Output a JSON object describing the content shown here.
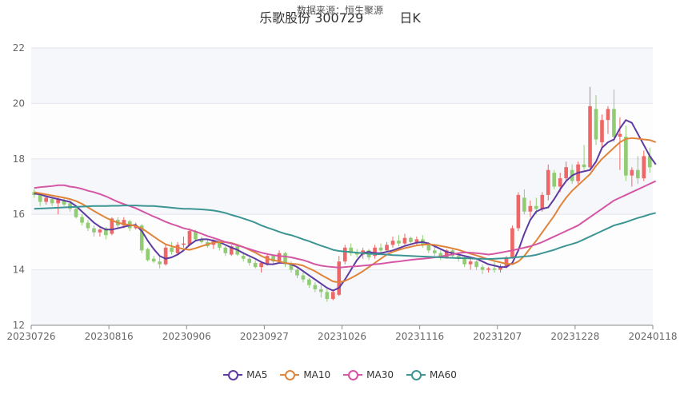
{
  "header": {
    "source": "数据来源：恒生聚源",
    "stock": "乐歌股份 300729",
    "period": "日K"
  },
  "colors": {
    "up": "#ee6666",
    "down": "#91cc75",
    "MA5": "#5e3ba0",
    "MA10": "#e0843b",
    "MA30": "#d456a4",
    "MA60": "#3c9593"
  },
  "chart_data": {
    "type": "candlestick",
    "title": "乐歌股份 300729",
    "subtitle": "日K",
    "ylim": [
      12,
      22
    ],
    "yticks": [
      12,
      14,
      16,
      18,
      20,
      22
    ],
    "xticks": [
      "20230726",
      "20230816",
      "20230906",
      "20230927",
      "20231026",
      "20231116",
      "20231207",
      "20231228",
      "20240118"
    ],
    "grid": true,
    "legend_position": "bottom",
    "legend": [
      "MA5",
      "MA10",
      "MA30",
      "MA60"
    ],
    "ohlc": [
      [
        16.8,
        16.9,
        16.6,
        16.7
      ],
      [
        16.7,
        16.75,
        16.3,
        16.45
      ],
      [
        16.45,
        16.7,
        16.35,
        16.6
      ],
      [
        16.55,
        16.6,
        16.3,
        16.4
      ],
      [
        16.4,
        16.6,
        16.0,
        16.55
      ],
      [
        16.5,
        16.6,
        16.3,
        16.35
      ],
      [
        16.4,
        16.5,
        16.1,
        16.2
      ],
      [
        16.2,
        16.3,
        15.85,
        15.9
      ],
      [
        15.9,
        16.0,
        15.6,
        15.7
      ],
      [
        15.7,
        15.8,
        15.4,
        15.5
      ],
      [
        15.5,
        15.6,
        15.2,
        15.35
      ],
      [
        15.35,
        15.5,
        15.2,
        15.45
      ],
      [
        15.5,
        15.55,
        15.1,
        15.25
      ],
      [
        15.3,
        15.9,
        15.25,
        15.85
      ],
      [
        15.8,
        15.9,
        15.5,
        15.6
      ],
      [
        15.6,
        15.9,
        15.5,
        15.8
      ],
      [
        15.75,
        15.8,
        15.4,
        15.5
      ],
      [
        15.5,
        15.7,
        15.45,
        15.6
      ],
      [
        15.6,
        15.65,
        14.6,
        14.7
      ],
      [
        14.75,
        14.8,
        14.3,
        14.35
      ],
      [
        14.4,
        14.5,
        14.25,
        14.3
      ],
      [
        14.3,
        14.5,
        14.05,
        14.2
      ],
      [
        14.2,
        14.9,
        14.15,
        14.8
      ],
      [
        14.8,
        15.0,
        14.55,
        14.65
      ],
      [
        14.6,
        15.0,
        14.55,
        14.9
      ],
      [
        14.9,
        15.2,
        14.8,
        14.95
      ],
      [
        14.9,
        15.5,
        14.85,
        15.4
      ],
      [
        15.4,
        15.45,
        15.05,
        15.1
      ],
      [
        15.1,
        15.2,
        14.95,
        15.0
      ],
      [
        15.0,
        15.1,
        14.8,
        14.85
      ],
      [
        14.9,
        15.1,
        14.75,
        15.05
      ],
      [
        15.0,
        15.05,
        14.7,
        14.8
      ],
      [
        14.8,
        14.85,
        14.5,
        14.6
      ],
      [
        14.55,
        14.9,
        14.5,
        14.85
      ],
      [
        14.85,
        14.9,
        14.5,
        14.55
      ],
      [
        14.5,
        14.65,
        14.3,
        14.4
      ],
      [
        14.4,
        14.45,
        14.15,
        14.25
      ],
      [
        14.25,
        14.35,
        14.05,
        14.1
      ],
      [
        14.1,
        14.3,
        13.9,
        14.25
      ],
      [
        14.2,
        14.6,
        14.15,
        14.5
      ],
      [
        14.5,
        14.55,
        14.2,
        14.3
      ],
      [
        14.3,
        14.7,
        14.25,
        14.6
      ],
      [
        14.6,
        14.65,
        14.1,
        14.2
      ],
      [
        14.2,
        14.3,
        13.9,
        14.0
      ],
      [
        14.0,
        14.05,
        13.7,
        13.8
      ],
      [
        13.8,
        13.9,
        13.55,
        13.65
      ],
      [
        13.65,
        13.7,
        13.35,
        13.45
      ],
      [
        13.45,
        13.55,
        13.2,
        13.3
      ],
      [
        13.3,
        13.45,
        13.0,
        13.2
      ],
      [
        13.2,
        13.3,
        12.85,
        12.95
      ],
      [
        12.95,
        13.3,
        12.9,
        13.2
      ],
      [
        13.1,
        14.5,
        13.05,
        14.3
      ],
      [
        14.3,
        14.9,
        14.2,
        14.8
      ],
      [
        14.8,
        14.95,
        14.5,
        14.6
      ],
      [
        14.6,
        14.75,
        14.45,
        14.55
      ],
      [
        14.55,
        14.8,
        14.4,
        14.7
      ],
      [
        14.7,
        14.75,
        14.35,
        14.45
      ],
      [
        14.5,
        14.9,
        14.4,
        14.8
      ],
      [
        14.8,
        14.95,
        14.6,
        14.7
      ],
      [
        14.7,
        15.0,
        14.65,
        14.9
      ],
      [
        14.9,
        15.2,
        14.8,
        15.05
      ],
      [
        15.05,
        15.25,
        14.85,
        14.95
      ],
      [
        14.95,
        15.3,
        14.9,
        15.15
      ],
      [
        15.15,
        15.2,
        14.9,
        15.0
      ],
      [
        15.0,
        15.2,
        14.85,
        15.1
      ],
      [
        15.1,
        15.25,
        14.8,
        14.9
      ],
      [
        14.9,
        15.0,
        14.6,
        14.7
      ],
      [
        14.7,
        14.85,
        14.5,
        14.6
      ],
      [
        14.6,
        14.7,
        14.35,
        14.45
      ],
      [
        14.45,
        14.75,
        14.4,
        14.7
      ],
      [
        14.7,
        14.8,
        14.45,
        14.5
      ],
      [
        14.5,
        14.6,
        14.3,
        14.4
      ],
      [
        14.4,
        14.5,
        14.1,
        14.2
      ],
      [
        14.2,
        14.4,
        14.0,
        14.3
      ],
      [
        14.3,
        14.35,
        14.0,
        14.1
      ],
      [
        14.1,
        14.2,
        13.85,
        14.0
      ],
      [
        14.0,
        14.1,
        13.9,
        14.05
      ],
      [
        14.05,
        14.3,
        13.9,
        14.0
      ],
      [
        14.0,
        14.2,
        13.9,
        14.1
      ],
      [
        14.1,
        14.5,
        14.05,
        14.45
      ],
      [
        14.45,
        15.6,
        14.4,
        15.5
      ],
      [
        15.5,
        16.8,
        15.4,
        16.7
      ],
      [
        16.6,
        16.9,
        16.0,
        16.1
      ],
      [
        16.1,
        16.5,
        15.9,
        16.3
      ],
      [
        16.3,
        16.6,
        16.0,
        16.2
      ],
      [
        16.2,
        16.8,
        16.1,
        16.7
      ],
      [
        16.7,
        17.8,
        16.5,
        17.6
      ],
      [
        17.5,
        17.6,
        16.9,
        17.0
      ],
      [
        17.0,
        17.5,
        16.8,
        17.3
      ],
      [
        17.3,
        17.9,
        17.2,
        17.7
      ],
      [
        17.6,
        17.8,
        17.1,
        17.2
      ],
      [
        17.2,
        17.9,
        17.1,
        17.8
      ],
      [
        17.8,
        18.5,
        17.6,
        17.7
      ],
      [
        17.7,
        20.6,
        17.6,
        19.9
      ],
      [
        19.8,
        20.3,
        18.5,
        18.7
      ],
      [
        18.6,
        19.6,
        18.4,
        19.4
      ],
      [
        19.4,
        19.9,
        18.9,
        19.8
      ],
      [
        19.8,
        20.5,
        18.6,
        18.8
      ],
      [
        18.8,
        19.5,
        17.6,
        18.9
      ],
      [
        18.8,
        19.2,
        17.2,
        17.4
      ],
      [
        17.4,
        17.7,
        17.0,
        17.6
      ],
      [
        17.6,
        18.1,
        17.1,
        17.3
      ],
      [
        17.3,
        18.3,
        17.2,
        18.1
      ],
      [
        18.1,
        18.4,
        17.5,
        17.7
      ]
    ],
    "series": [
      {
        "name": "MA5",
        "values": [
          16.75,
          16.72,
          16.65,
          16.6,
          16.55,
          16.5,
          16.45,
          16.3,
          16.1,
          15.9,
          15.7,
          15.55,
          15.45,
          15.45,
          15.5,
          15.55,
          15.6,
          15.62,
          15.4,
          15.05,
          14.75,
          14.5,
          14.4,
          14.45,
          14.55,
          14.7,
          14.9,
          15.05,
          15.1,
          15.1,
          15.05,
          15.0,
          14.9,
          14.8,
          14.72,
          14.6,
          14.5,
          14.4,
          14.28,
          14.2,
          14.2,
          14.25,
          14.25,
          14.2,
          14.1,
          13.95,
          13.8,
          13.65,
          13.5,
          13.35,
          13.25,
          13.35,
          13.65,
          14.0,
          14.35,
          14.6,
          14.65,
          14.6,
          14.6,
          14.65,
          14.7,
          14.78,
          14.86,
          14.92,
          14.98,
          15.0,
          14.95,
          14.85,
          14.75,
          14.65,
          14.6,
          14.55,
          14.5,
          14.45,
          14.4,
          14.3,
          14.2,
          14.15,
          14.1,
          14.1,
          14.25,
          14.7,
          15.3,
          15.8,
          16.1,
          16.2,
          16.25,
          16.55,
          16.9,
          17.2,
          17.4,
          17.5,
          17.55,
          17.6,
          17.9,
          18.4,
          18.6,
          18.7,
          19.1,
          19.4,
          19.3,
          18.9,
          18.5,
          18.1,
          17.8
        ]
      },
      {
        "name": "MA10",
        "values": [
          16.8,
          16.76,
          16.72,
          16.68,
          16.64,
          16.6,
          16.55,
          16.48,
          16.38,
          16.25,
          16.12,
          16.0,
          15.88,
          15.78,
          15.7,
          15.65,
          15.62,
          15.58,
          15.5,
          15.35,
          15.2,
          15.05,
          14.92,
          14.85,
          14.8,
          14.75,
          14.72,
          14.78,
          14.85,
          14.92,
          14.98,
          15.0,
          15.0,
          14.97,
          14.9,
          14.82,
          14.72,
          14.62,
          14.5,
          14.4,
          14.35,
          14.3,
          14.25,
          14.22,
          14.2,
          14.15,
          14.05,
          13.95,
          13.82,
          13.7,
          13.58,
          13.55,
          13.6,
          13.7,
          13.82,
          13.95,
          14.1,
          14.25,
          14.4,
          14.55,
          14.65,
          14.72,
          14.78,
          14.83,
          14.88,
          14.9,
          14.92,
          14.9,
          14.86,
          14.82,
          14.77,
          14.72,
          14.65,
          14.58,
          14.52,
          14.45,
          14.38,
          14.32,
          14.27,
          14.22,
          14.2,
          14.3,
          14.5,
          14.78,
          15.05,
          15.35,
          15.65,
          15.95,
          16.3,
          16.6,
          16.85,
          17.05,
          17.25,
          17.45,
          17.75,
          18.0,
          18.2,
          18.4,
          18.6,
          18.72,
          18.75,
          18.73,
          18.7,
          18.68,
          18.6
        ]
      },
      {
        "name": "MA30",
        "values": [
          16.95,
          16.98,
          17.0,
          17.02,
          17.05,
          17.05,
          17.0,
          16.97,
          16.92,
          16.85,
          16.8,
          16.73,
          16.65,
          16.55,
          16.45,
          16.37,
          16.3,
          16.22,
          16.12,
          16.02,
          15.92,
          15.83,
          15.73,
          15.65,
          15.58,
          15.5,
          15.45,
          15.38,
          15.3,
          15.22,
          15.15,
          15.08,
          15.0,
          14.95,
          14.88,
          14.82,
          14.75,
          14.68,
          14.62,
          14.57,
          14.53,
          14.5,
          14.48,
          14.45,
          14.4,
          14.35,
          14.28,
          14.2,
          14.15,
          14.12,
          14.1,
          14.08,
          14.1,
          14.12,
          14.13,
          14.15,
          14.17,
          14.2,
          14.22,
          14.25,
          14.28,
          14.3,
          14.33,
          14.36,
          14.38,
          14.4,
          14.42,
          14.45,
          14.48,
          14.52,
          14.56,
          14.6,
          14.63,
          14.62,
          14.6,
          14.58,
          14.55,
          14.58,
          14.62,
          14.66,
          14.7,
          14.75,
          14.8,
          14.85,
          14.92,
          15.0,
          15.1,
          15.2,
          15.3,
          15.4,
          15.5,
          15.6,
          15.75,
          15.9,
          16.05,
          16.2,
          16.35,
          16.5,
          16.6,
          16.7,
          16.8,
          16.9,
          17.0,
          17.1,
          17.2
        ]
      },
      {
        "name": "MA60",
        "values": [
          16.2,
          16.21,
          16.22,
          16.23,
          16.24,
          16.25,
          16.26,
          16.27,
          16.28,
          16.29,
          16.3,
          16.3,
          16.3,
          16.31,
          16.31,
          16.32,
          16.32,
          16.32,
          16.31,
          16.3,
          16.3,
          16.28,
          16.26,
          16.24,
          16.22,
          16.2,
          16.2,
          16.19,
          16.18,
          16.16,
          16.14,
          16.1,
          16.05,
          15.98,
          15.92,
          15.85,
          15.78,
          15.7,
          15.6,
          15.52,
          15.45,
          15.37,
          15.3,
          15.25,
          15.18,
          15.1,
          15.03,
          14.95,
          14.87,
          14.8,
          14.72,
          14.68,
          14.66,
          14.64,
          14.62,
          14.6,
          14.58,
          14.57,
          14.56,
          14.55,
          14.53,
          14.52,
          14.51,
          14.5,
          14.49,
          14.48,
          14.47,
          14.46,
          14.45,
          14.44,
          14.43,
          14.42,
          14.42,
          14.41,
          14.4,
          14.4,
          14.39,
          14.4,
          14.41,
          14.42,
          14.44,
          14.46,
          14.48,
          14.5,
          14.54,
          14.6,
          14.66,
          14.72,
          14.8,
          14.87,
          14.93,
          15.0,
          15.1,
          15.2,
          15.3,
          15.4,
          15.5,
          15.6,
          15.66,
          15.72,
          15.8,
          15.87,
          15.93,
          16.0,
          16.05
        ]
      }
    ]
  }
}
